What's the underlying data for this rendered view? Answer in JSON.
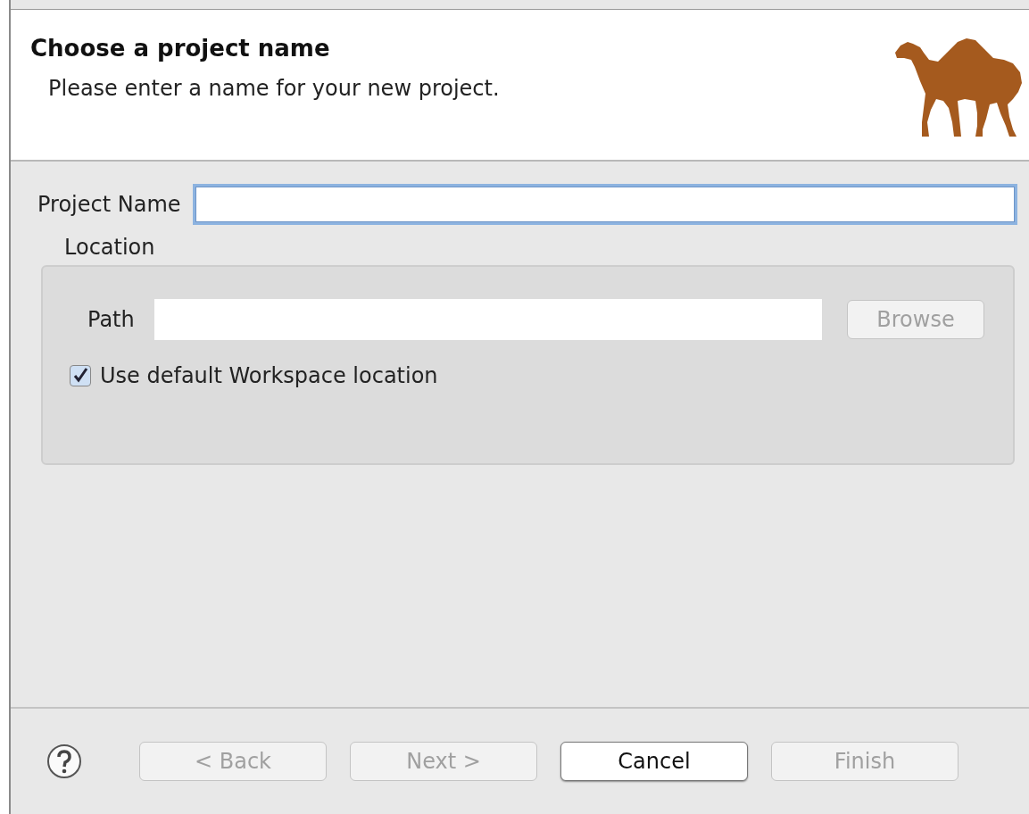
{
  "header": {
    "title": "Choose a project name",
    "subtitle": "Please enter a name for your new project."
  },
  "project_name": {
    "label": "Project Name",
    "focused": true
  },
  "location": {
    "label": "Location",
    "path_label": "Path",
    "browse": {
      "label": "Browse",
      "disabled": true
    },
    "use_default": {
      "label": "Use default Workspace location",
      "checked": true
    }
  },
  "buttons": [
    {
      "label": "< Back",
      "disabled": true,
      "default": false
    },
    {
      "label": "Next >",
      "disabled": true,
      "default": false
    },
    {
      "label": "Cancel",
      "disabled": false,
      "default": true
    },
    {
      "label": "Finish",
      "disabled": true,
      "default": false
    }
  ]
}
